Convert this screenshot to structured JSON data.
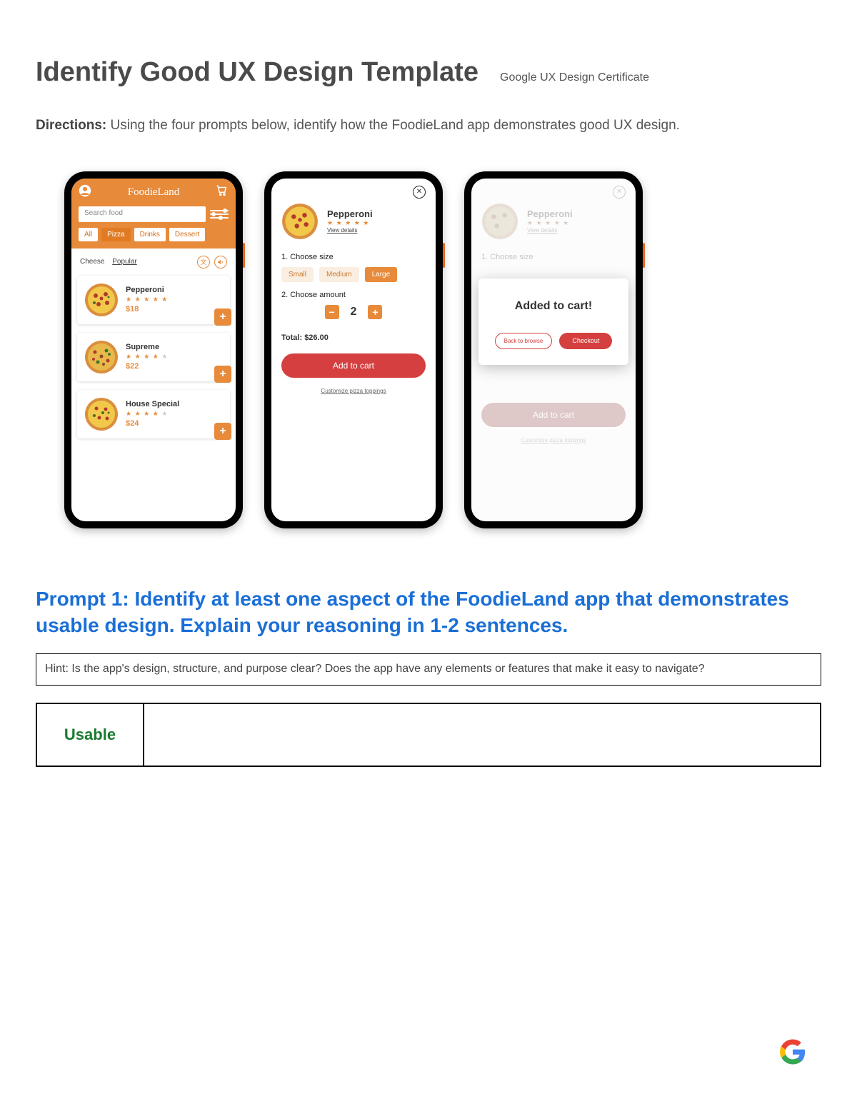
{
  "header": {
    "title": "Identify Good UX Design Template",
    "subtitle": "Google UX Design Certificate"
  },
  "directions": {
    "label": "Directions:",
    "text": " Using the four prompts below, identify how the FoodieLand app demonstrates good UX design."
  },
  "phone1": {
    "brand": "FoodieLand",
    "search_placeholder": "Search food",
    "tabs": {
      "all": "All",
      "pizza": "Pizza",
      "drinks": "Drinks",
      "dessert": "Dessert"
    },
    "filters": {
      "cheese": "Cheese",
      "popular": "Popular"
    },
    "items": [
      {
        "name": "Pepperoni",
        "price": "$18",
        "stars": 5
      },
      {
        "name": "Supreme",
        "price": "$22",
        "stars": 4
      },
      {
        "name": "House Special",
        "price": "$24",
        "stars": 4
      }
    ]
  },
  "phone2": {
    "product": "Pepperoni",
    "view_details": "View details",
    "size_label": "1. Choose size",
    "sizes": {
      "small": "Small",
      "medium": "Medium",
      "large": "Large"
    },
    "amount_label": "2. Choose amount",
    "quantity": "2",
    "total_label": "Total: ",
    "total_value": "$26.00",
    "add_to_cart": "Add to cart",
    "customize": "Customize pizza toppings"
  },
  "phone3": {
    "message": "Added to cart!",
    "back": "Back to browse",
    "checkout": "Checkout",
    "faded_add": "Add to cart",
    "faded_custom": "Customize pizza toppings",
    "faded_size": "1. Choose size",
    "faded_name": "Pepperoni",
    "faded_details": "View details"
  },
  "prompt1": "Prompt 1: Identify at least one aspect of the FoodieLand app that demonstrates usable design. Explain your reasoning in 1-2 sentences.",
  "hint": "Hint: Is the app's design, structure, and purpose clear? Does the app have any elements or features that make it easy to navigate?",
  "answer_label": "Usable"
}
